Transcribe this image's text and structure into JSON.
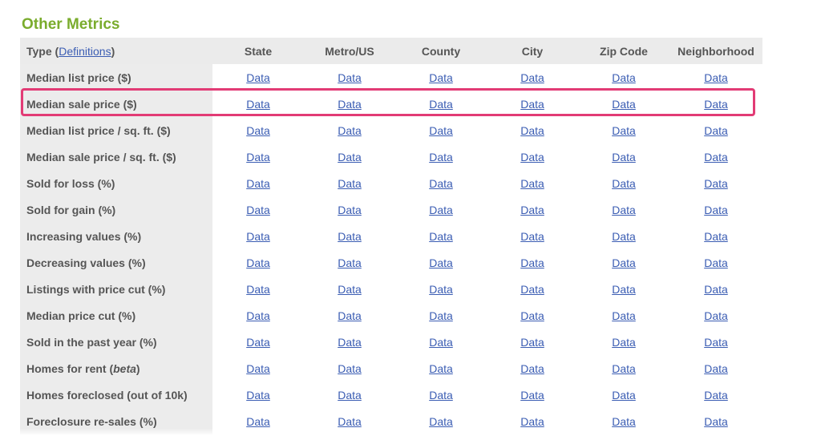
{
  "section": {
    "title": "Other Metrics"
  },
  "table": {
    "type_label": "Type (",
    "definitions_link": "Definitions",
    "type_label_close": ")",
    "columns": [
      "State",
      "Metro/US",
      "County",
      "City",
      "Zip Code",
      "Neighborhood"
    ],
    "rows": [
      {
        "label": "Median list price ($)",
        "suffix": ""
      },
      {
        "label": "Median sale price ($)",
        "suffix": ""
      },
      {
        "label": "Median list price / sq. ft. ($)",
        "suffix": ""
      },
      {
        "label": "Median sale price / sq. ft. ($)",
        "suffix": ""
      },
      {
        "label": "Sold for loss (%)",
        "suffix": ""
      },
      {
        "label": "Sold for gain (%)",
        "suffix": ""
      },
      {
        "label": "Increasing values (%)",
        "suffix": ""
      },
      {
        "label": "Decreasing values (%)",
        "suffix": ""
      },
      {
        "label": "Listings with price cut (%)",
        "suffix": ""
      },
      {
        "label": "Median price cut (%)",
        "suffix": ""
      },
      {
        "label": "Sold in the past year (%)",
        "suffix": ""
      },
      {
        "label": "Homes for rent (",
        "italic": "beta",
        "suffix": ")"
      },
      {
        "label": "Homes foreclosed (out of 10k)",
        "suffix": ""
      },
      {
        "label": "Foreclosure re-sales (%)",
        "suffix": ""
      }
    ],
    "cell_link_text": "Data"
  },
  "highlight": {
    "row_label": "Median sale price ($)",
    "color": "#e23b75"
  },
  "colors": {
    "title_green": "#7aac2d",
    "link_blue": "#3b5db3",
    "label_bg": "#ececec",
    "text_gray": "#555555"
  }
}
